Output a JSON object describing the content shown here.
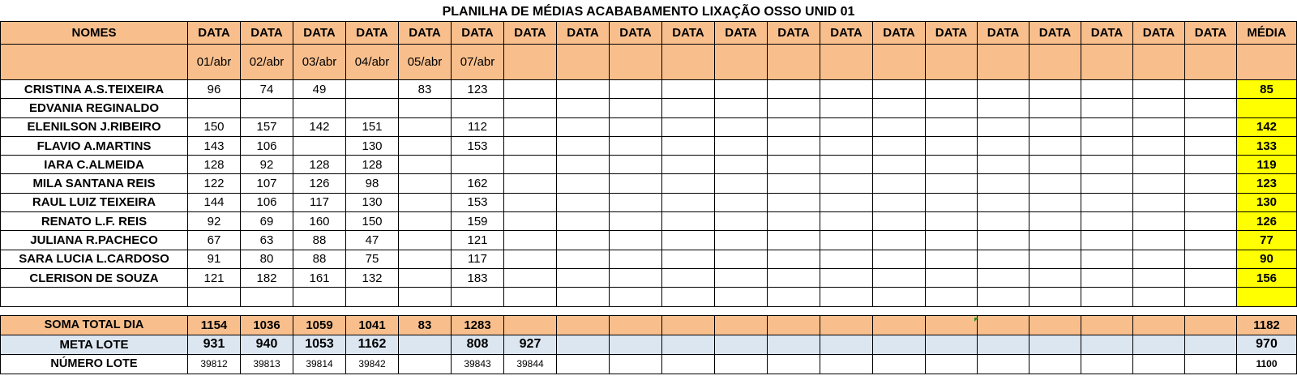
{
  "title": "PLANILHA DE MÉDIAS ACABABAMENTO LIXAÇÃO OSSO UNID 01",
  "header": {
    "names_label": "NOMES",
    "date_label": "DATA",
    "media_label": "MÉDIA",
    "dates": [
      "01/abr",
      "02/abr",
      "03/abr",
      "04/abr",
      "05/abr",
      "07/abr",
      "",
      "",
      "",
      "",
      "",
      "",
      "",
      "",
      "",
      "",
      "",
      "",
      "",
      ""
    ]
  },
  "rows": [
    {
      "name": "CRISTINA A.S.TEIXEIRA",
      "values": [
        "96",
        "74",
        "49",
        "",
        "83",
        "123"
      ],
      "media": "85"
    },
    {
      "name": "EDVANIA REGINALDO",
      "values": [
        "",
        "",
        "",
        "",
        "",
        ""
      ],
      "media": ""
    },
    {
      "name": "ELENILSON J.RIBEIRO",
      "values": [
        "150",
        "157",
        "142",
        "151",
        "",
        "112"
      ],
      "media": "142"
    },
    {
      "name": "FLAVIO A.MARTINS",
      "values": [
        "143",
        "106",
        "",
        "130",
        "",
        "153"
      ],
      "media": "133"
    },
    {
      "name": "IARA C.ALMEIDA",
      "values": [
        "128",
        "92",
        "128",
        "128",
        "",
        ""
      ],
      "media": "119"
    },
    {
      "name": "MILA SANTANA REIS",
      "values": [
        "122",
        "107",
        "126",
        "98",
        "",
        "162"
      ],
      "media": "123"
    },
    {
      "name": "RAUL LUIZ TEIXEIRA",
      "values": [
        "144",
        "106",
        "117",
        "130",
        "",
        "153"
      ],
      "media": "130"
    },
    {
      "name": "RENATO L.F. REIS",
      "values": [
        "92",
        "69",
        "160",
        "150",
        "",
        "159"
      ],
      "media": "126"
    },
    {
      "name": "JULIANA R.PACHECO",
      "values": [
        "67",
        "63",
        "88",
        "47",
        "",
        "121"
      ],
      "media": "77"
    },
    {
      "name": "SARA LUCIA L.CARDOSO",
      "values": [
        "91",
        "80",
        "88",
        "75",
        "",
        "117"
      ],
      "media": "90"
    },
    {
      "name": "CLERISON DE SOUZA",
      "values": [
        "121",
        "182",
        "161",
        "132",
        "",
        "183"
      ],
      "media": "156"
    },
    {
      "name": "",
      "values": [
        "",
        "",
        "",
        "",
        "",
        ""
      ],
      "media": ""
    }
  ],
  "summary": {
    "soma": {
      "label": "SOMA TOTAL DIA",
      "values": [
        "1154",
        "1036",
        "1059",
        "1041",
        "83",
        "1283",
        ""
      ],
      "media": "1182"
    },
    "meta": {
      "label": "META LOTE",
      "values": [
        "931",
        "940",
        "1053",
        "1162",
        "",
        "808",
        "927"
      ],
      "media": "970"
    },
    "lote": {
      "label": "NÚMERO LOTE",
      "values": [
        "39812",
        "39813",
        "39814",
        "39842",
        "",
        "39843",
        "39844"
      ],
      "media": "1100"
    }
  },
  "colors": {
    "header_bg": "#f8bf8d",
    "media_bg": "#ffff00",
    "meta_bg": "#dce6f1"
  }
}
